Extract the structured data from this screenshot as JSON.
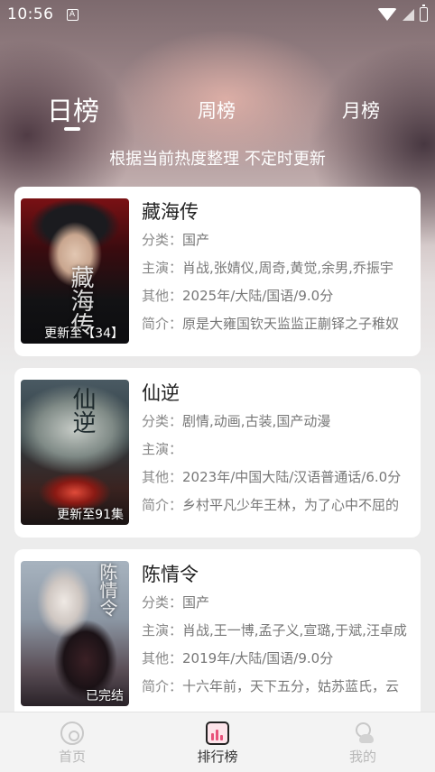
{
  "status_bar": {
    "time": "10:56",
    "notification_icon": "A"
  },
  "tabs": [
    {
      "label": "日榜",
      "active": true
    },
    {
      "label": "周榜",
      "active": false
    },
    {
      "label": "月榜",
      "active": false
    }
  ],
  "subtitle": "根据当前热度整理 不定时更新",
  "items": [
    {
      "title": "藏海传",
      "category_key": "分类：",
      "category": "国产",
      "cast_key": "主演：",
      "cast": "肖战,张婧仪,周奇,黄觉,余男,乔振宇",
      "other_key": "其他：",
      "other": "2025年/大陆/国语/9.0分",
      "intro_key": "简介：",
      "intro": "原是大雍国钦天监监正蒯铎之子稚奴",
      "badge": "更新至【34】",
      "poster_title": "藏海传"
    },
    {
      "title": "仙逆",
      "category_key": "分类：",
      "category": "剧情,动画,古装,国产动漫",
      "cast_key": "主演：",
      "cast": "",
      "other_key": "其他：",
      "other": "2023年/中国大陆/汉语普通话/6.0分",
      "intro_key": "简介：",
      "intro": "乡村平凡少年王林，为了心中不屈的",
      "badge": "更新至91集",
      "poster_title": "仙逆"
    },
    {
      "title": "陈情令",
      "category_key": "分类：",
      "category": "国产",
      "cast_key": "主演：",
      "cast": "肖战,王一博,孟子义,宣璐,于斌,汪卓成",
      "other_key": "其他：",
      "other": "2019年/大陆/国语/9.0分",
      "intro_key": "简介：",
      "intro": "十六年前，天下五分，姑苏蓝氏，云",
      "badge": "已完结",
      "poster_title": "陈情令"
    }
  ],
  "bottom_nav": [
    {
      "label": "首页",
      "icon": "home-icon",
      "active": false
    },
    {
      "label": "排行榜",
      "icon": "ranking-icon",
      "active": true
    },
    {
      "label": "我的",
      "icon": "profile-icon",
      "active": false
    }
  ],
  "colors": {
    "active_tab_text": "#333333",
    "inactive_tab_text": "#b8b8b8",
    "ranking_icon_accent": "#e8507a"
  }
}
